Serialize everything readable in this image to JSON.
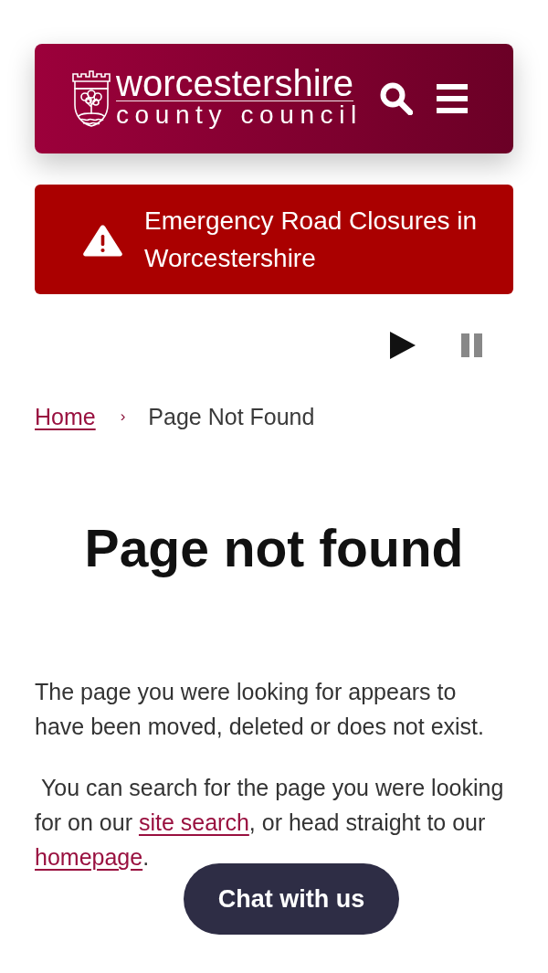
{
  "header": {
    "logo": {
      "title": "worcestershire",
      "subtitle": "county council"
    }
  },
  "alert": {
    "text": "Emergency Road Closures in Worcestershire"
  },
  "media_controls": [
    {
      "kind": "play",
      "disabled": false
    },
    {
      "kind": "pause",
      "disabled": true
    }
  ],
  "breadcrumb": {
    "items": [
      {
        "label": "Home",
        "kind": "link"
      },
      {
        "label": "Page Not Found",
        "kind": "current"
      }
    ],
    "separator": "›"
  },
  "heading": "Page not found",
  "paragraphs": [
    {
      "parts": [
        {
          "kind": "text",
          "text": "The page you were looking for appears to have been moved, deleted or does not exist."
        }
      ]
    },
    {
      "parts": [
        {
          "kind": "text",
          "text": " You can search for the page you were looking for on our "
        },
        {
          "kind": "link",
          "text": "site search"
        },
        {
          "kind": "text",
          "text": ", or head straight to our "
        },
        {
          "kind": "link",
          "text": "homepage"
        },
        {
          "kind": "text",
          "text": "."
        }
      ]
    }
  ],
  "chat_button": {
    "label": "Chat with us"
  }
}
